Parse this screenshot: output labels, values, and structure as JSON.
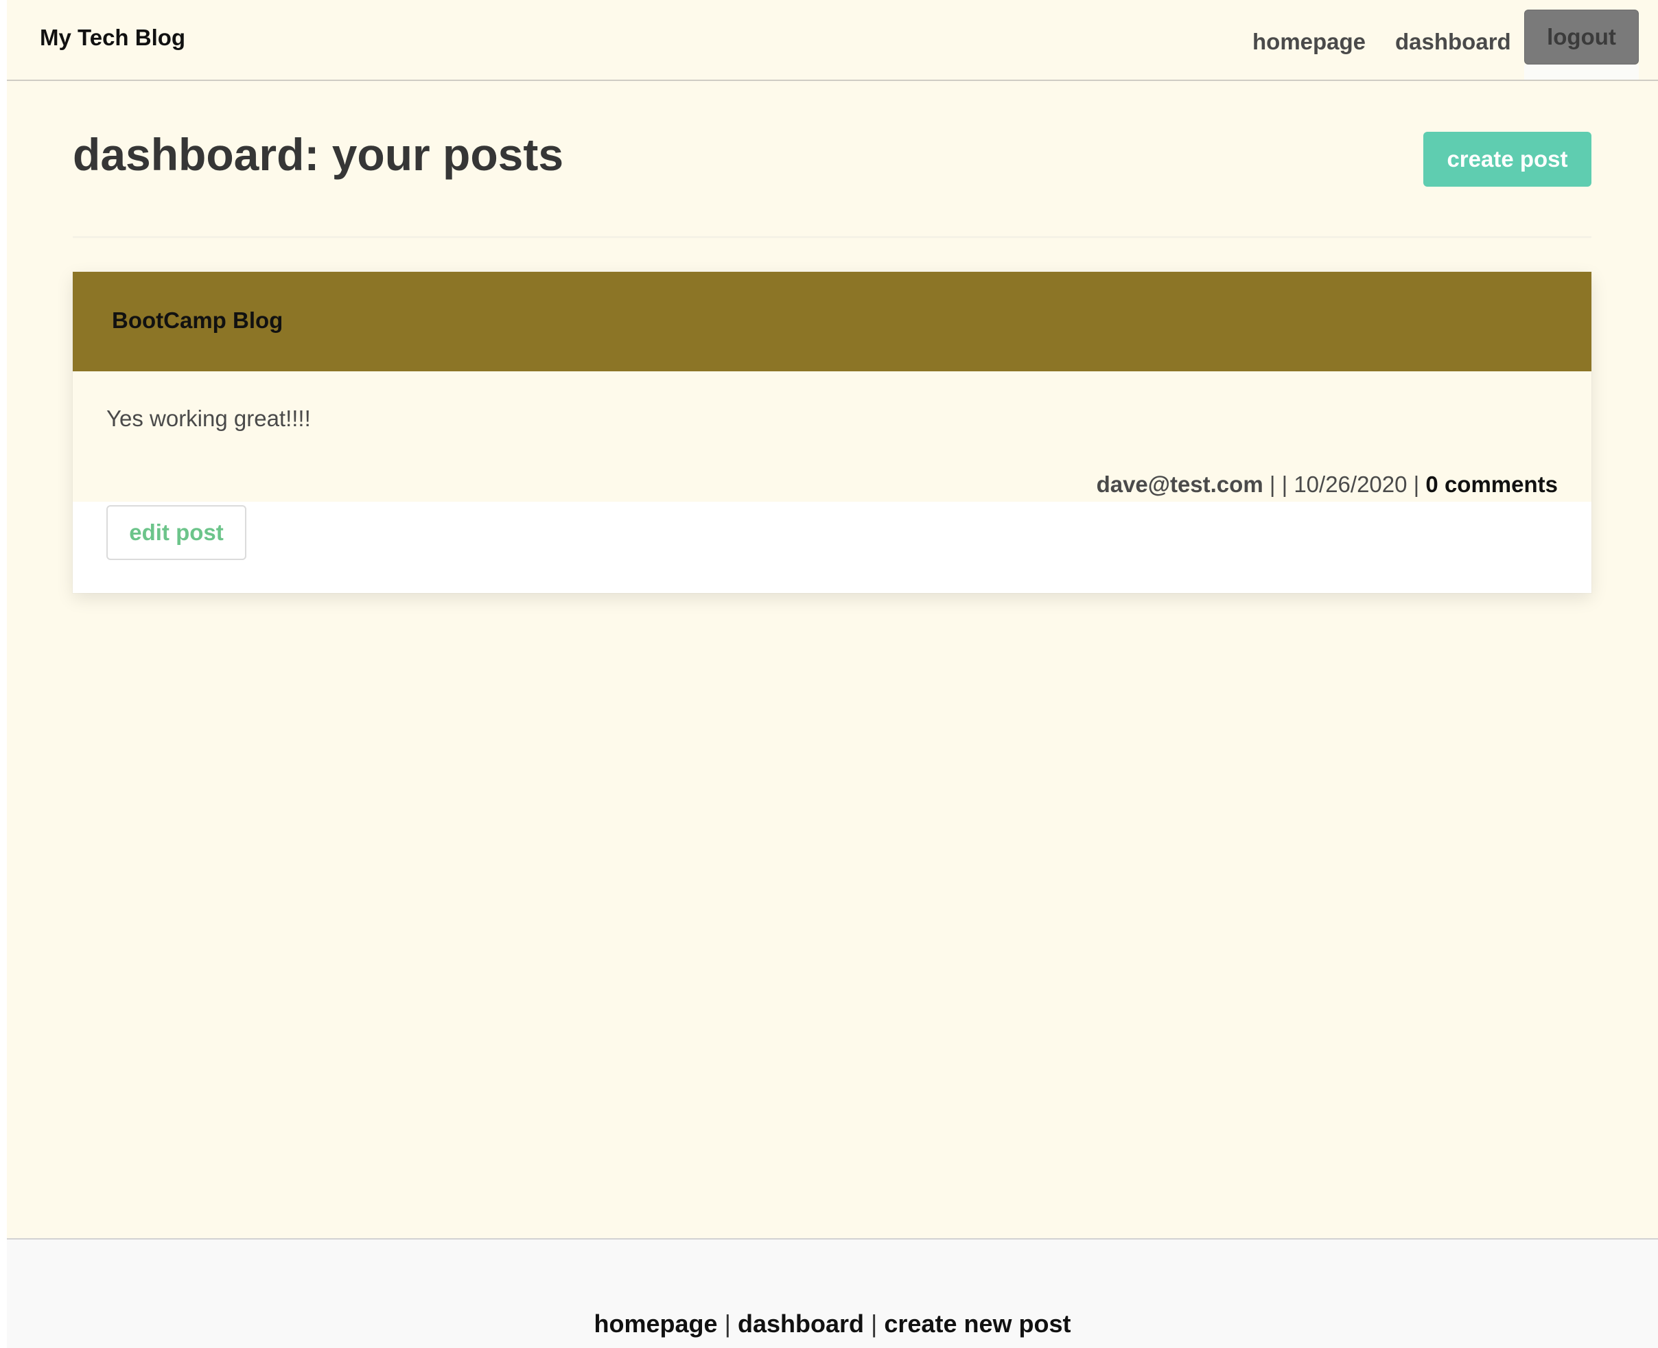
{
  "navbar": {
    "brand": "My Tech Blog",
    "links": {
      "homepage": "homepage",
      "dashboard": "dashboard"
    },
    "logout_label": "logout"
  },
  "dashboard": {
    "title": "dashboard: your posts",
    "create_label": "create post"
  },
  "posts": [
    {
      "title": "BootCamp Blog",
      "content": "Yes working great!!!!",
      "author": "dave@test.com",
      "separator_1": " | | ",
      "date": "10/26/2020",
      "separator_2": " | ",
      "comments": "0 comments",
      "edit_label": "edit post"
    }
  ],
  "footer": {
    "homepage": "homepage",
    "dashboard": "dashboard",
    "create_new_post": "create new post",
    "separator": "|"
  },
  "colors": {
    "page_background": "#fefaeb",
    "post_header": "#8c7526",
    "create_button": "#5fcdb0",
    "logout_button": "#7a7a7a",
    "edit_text": "#6cc48a"
  }
}
